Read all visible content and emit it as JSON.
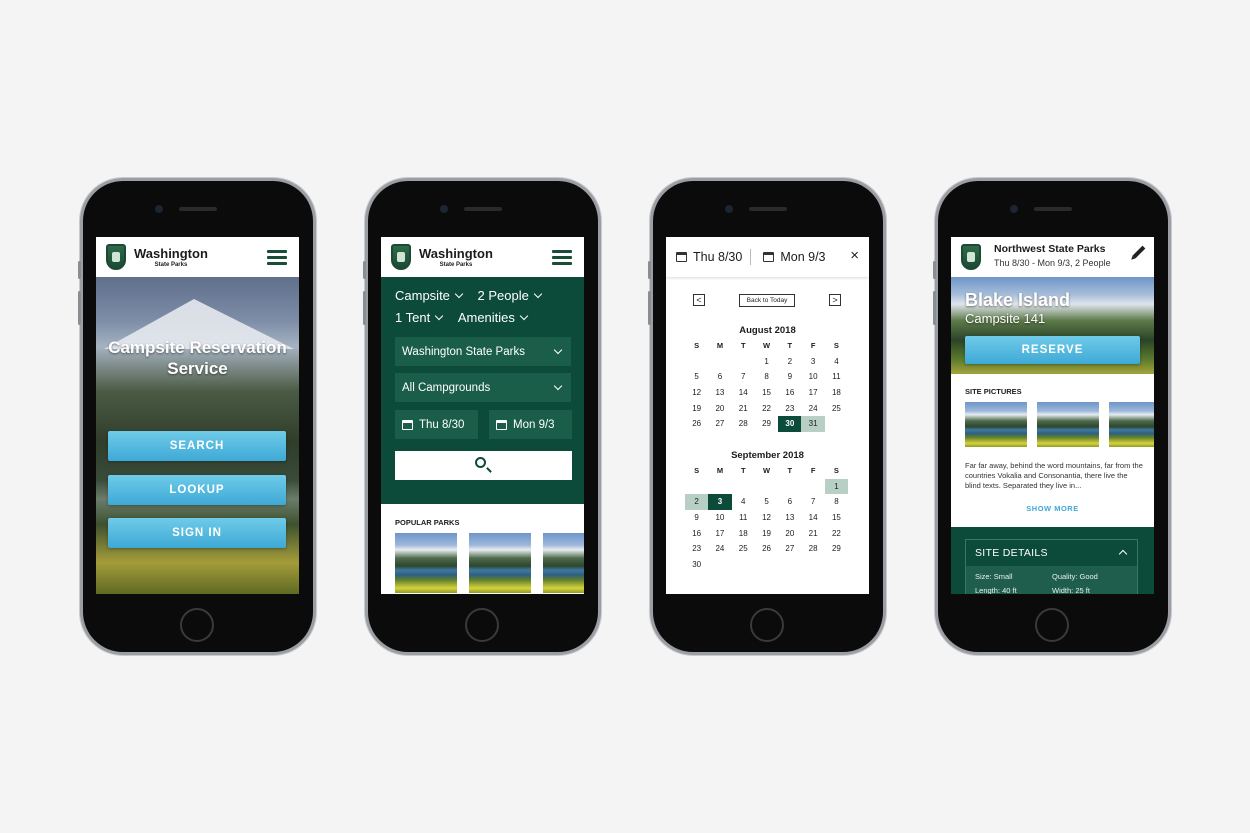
{
  "brand": {
    "title": "Washington",
    "subtitle": "State Parks"
  },
  "screen1": {
    "hero_title": "Campsite Reservation Service",
    "buttons": [
      "SEARCH",
      "LOOKUP",
      "SIGN IN"
    ]
  },
  "screen2": {
    "filters": {
      "site_type": "Campsite",
      "people": "2 People",
      "tents": "1 Tent",
      "amenities": "Amenities"
    },
    "park_select": "Washington State Parks",
    "campground_select": "All Campgrounds",
    "check_in": "Thu 8/30",
    "check_out": "Mon 9/3",
    "popular_label": "POPULAR PARKS"
  },
  "screen3": {
    "check_in": "Thu 8/30",
    "check_out": "Mon 9/3",
    "close_label": "×",
    "back_to_today": "Back to Today",
    "prev_label": "<",
    "next_label": ">",
    "weekdays": [
      "S",
      "M",
      "T",
      "W",
      "T",
      "F",
      "S"
    ],
    "months": [
      {
        "title": "August 2018",
        "days": [
          "",
          "",
          "",
          "1",
          "2",
          "3",
          "4",
          "5",
          "6",
          "7",
          "8",
          "9",
          "10",
          "11",
          "12",
          "13",
          "14",
          "15",
          "16",
          "17",
          "18",
          "19",
          "20",
          "21",
          "22",
          "23",
          "24",
          "25",
          "26",
          "27",
          "28",
          "29",
          "30",
          "31"
        ],
        "selected": [
          "30"
        ],
        "range": [
          "31"
        ]
      },
      {
        "title": "September 2018",
        "days": [
          "",
          "",
          "",
          "",
          "",
          "",
          "1",
          "2",
          "3",
          "4",
          "5",
          "6",
          "7",
          "8",
          "9",
          "10",
          "11",
          "12",
          "13",
          "14",
          "15",
          "16",
          "17",
          "18",
          "19",
          "20",
          "21",
          "22",
          "23",
          "24",
          "25",
          "26",
          "27",
          "28",
          "29",
          "30"
        ],
        "selected": [
          "3"
        ],
        "range": [
          "1",
          "2"
        ]
      }
    ]
  },
  "screen4": {
    "park_name": "Northwest State Parks",
    "trip_summary": "Thu 8/30 - Mon 9/3, 2 People",
    "site_name": "Blake Island",
    "site_number": "Campsite 141",
    "reserve_label": "RESERVE",
    "pictures_label": "SITE PICTURES",
    "description": "Far far away, behind the word mountains, far from the countries Vokalia and Consonantia, there live the blind texts. Separated they live in...",
    "show_more": "SHOW MORE",
    "details_title": "SITE DETAILS",
    "details": {
      "size": "Size: Small",
      "quality": "Quality: Good",
      "length": "Length: 40 ft",
      "width": "Width: 25 ft"
    }
  },
  "colors": {
    "primary_green": "#0c4a3a",
    "accent_blue": "#3ea9d6",
    "range_green": "#b8cfc6"
  }
}
